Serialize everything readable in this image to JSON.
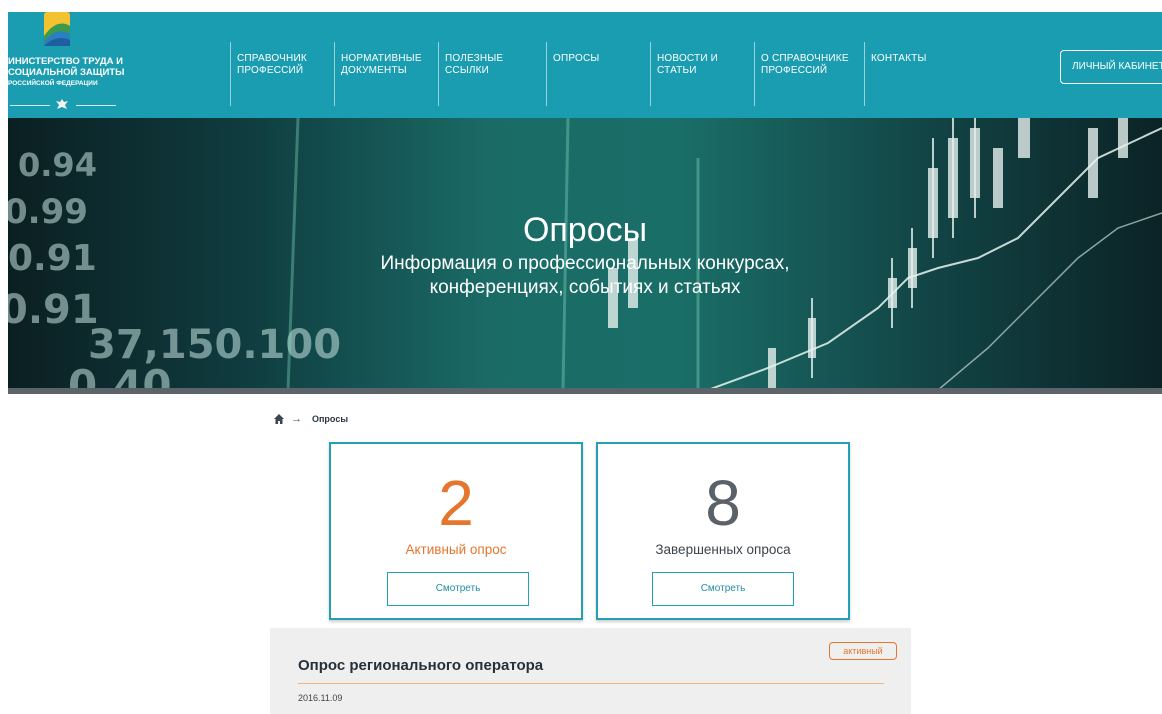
{
  "header": {
    "logo": {
      "line1": "ИНИСТЕРСТВО ТРУДА И",
      "line2": "СОЦИАЛЬНОЙ ЗАЩИТЫ",
      "line3": "РОССИЙСКОЙ ФЕДЕРАЦИИ"
    },
    "nav": [
      {
        "l1": "СПРАВОЧНИК",
        "l2": "ПРОФЕССИЙ"
      },
      {
        "l1": "НОРМАТИВНЫЕ",
        "l2": "ДОКУМЕНТЫ"
      },
      {
        "l1": "ПОЛЕЗНЫЕ",
        "l2": "ССЫЛКИ"
      },
      {
        "l1": "ОПРОСЫ",
        "l2": ""
      },
      {
        "l1": "НОВОСТИ И",
        "l2": "СТАТЬИ"
      },
      {
        "l1": "О СПРАВОЧНИКЕ",
        "l2": "ПРОФЕССИЙ"
      },
      {
        "l1": "КОНТАКТЫ",
        "l2": ""
      }
    ],
    "cabinet_label": "ЛИЧНЫЙ КАБИНЕТ"
  },
  "hero": {
    "title": "Опросы",
    "subtitle_line1": "Информация о профессиональных конкурсах,",
    "subtitle_line2": "конференциях, событиях и статьях"
  },
  "breadcrumb": {
    "arrow": "→",
    "current": "Опросы"
  },
  "stats": {
    "active": {
      "count": "2",
      "label": "Активный опрос",
      "button": "Смотреть",
      "color": "#e5762d"
    },
    "finished": {
      "count": "8",
      "label": "Завершенных опроса",
      "button": "Смотреть",
      "color": "#5b6168"
    }
  },
  "survey": {
    "title": "Опрос регионального оператора",
    "date": "2016.11.09",
    "badge": "активный"
  },
  "colors": {
    "header_bg": "#1b9db1",
    "accent": "#23a0b4",
    "orange": "#e5762d"
  }
}
